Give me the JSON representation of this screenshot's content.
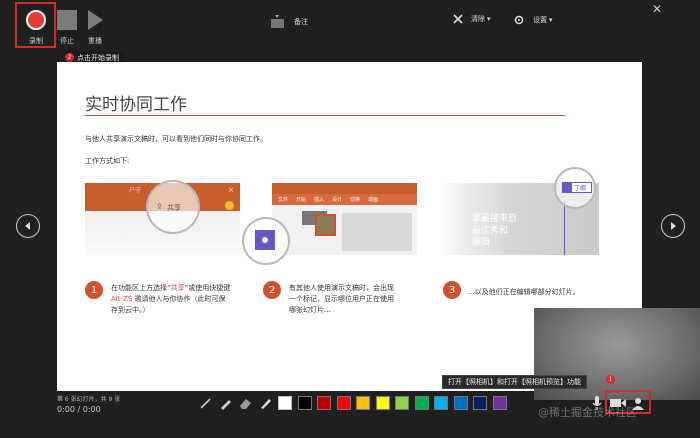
{
  "toolbar": {
    "record_label": "录制",
    "stop_label": "停止",
    "replay_label": "重播",
    "notes_label": "备注",
    "clear_label": "清除",
    "settings_label": "设置",
    "dropdown_glyph": "▾",
    "close_glyph": "✕"
  },
  "tooltip_record": {
    "badge": "2",
    "text": "点击开始录制"
  },
  "slide": {
    "title": "实时协同工作",
    "line1": "与他人共享演示文稿时，可以看到他们同时与你协同工作。",
    "line2": "工作方式如下:",
    "panel1": {
      "share_label": "共享",
      "ribbon_fragment": "户守"
    },
    "panel2": {
      "tabs": [
        "文件",
        "开始",
        "插入",
        "设计",
        "切换",
        "动画"
      ]
    },
    "panel3": {
      "user_label": "丁娜",
      "bg_text_1": "享最接来自",
      "bg_text_2": "最优秀和",
      "bg_text_3": "编辑"
    },
    "steps": [
      {
        "num": "1",
        "text_a": "在功能区上方选择“",
        "highlight_a": "共享",
        "text_b": "”或使用快捷键 ",
        "highlight_b": "Alt-ZS",
        "text_c": " 邀请他人与你协作（此时可保存到云中。）"
      },
      {
        "num": "2",
        "text": "有其他人使用演示文稿时，会出现一个标记，显示哪位用户正在使用哪张幻灯片..."
      },
      {
        "num": "3",
        "text": "...以及他们正在编辑哪部分幻灯片。"
      }
    ]
  },
  "bottom": {
    "slide_count": "第 6 张幻灯片，共 9 张",
    "timer": "0:00  /  0:00"
  },
  "colors": {
    "swatches": [
      "#ffffff",
      "#000000",
      "#c00000",
      "#ff0000",
      "#ffc000",
      "#ffff00",
      "#92d050",
      "#00b050",
      "#00b0f0",
      "#0070c0",
      "#002060",
      "#7030a0"
    ],
    "accent": "#d42a2a",
    "slide_accent": "#d0512c"
  },
  "tooltip_camera": {
    "text": "打开【照相机】和打开【照相机预览】功能",
    "badge": "1"
  },
  "watermark": "@稀土掘金技术社区",
  "icons": [
    "record-icon",
    "stop-icon",
    "replay-icon",
    "notes-icon",
    "clear-icon",
    "settings-icon",
    "pen-icon",
    "highlighter-icon",
    "eraser-icon",
    "microphone-icon",
    "camera-icon",
    "camera-preview-icon",
    "prev-slide-icon",
    "next-slide-icon"
  ]
}
